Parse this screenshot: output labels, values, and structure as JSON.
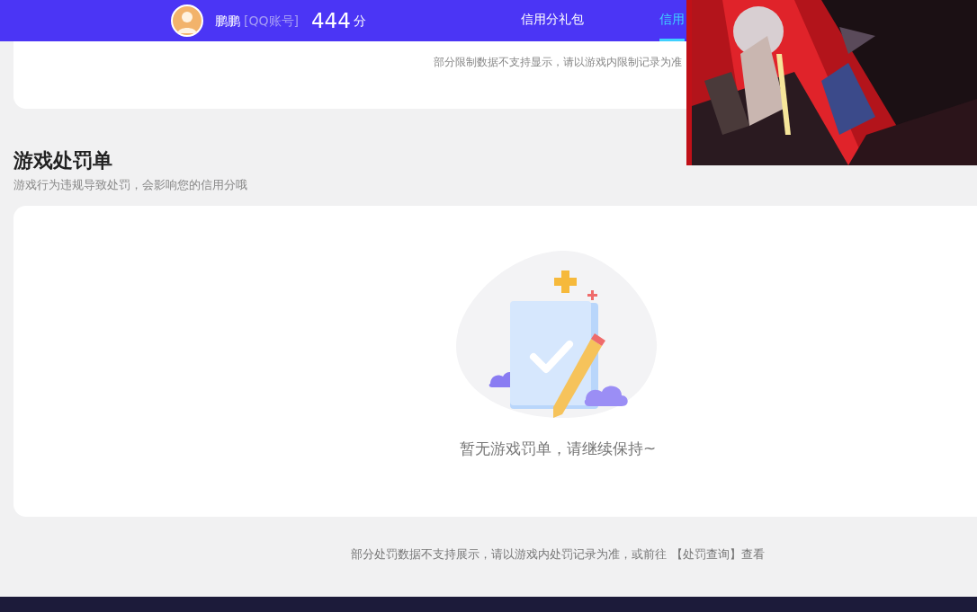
{
  "header": {
    "user_name": "鹏鹏",
    "account_type": "[QQ账号]",
    "score": "444",
    "score_unit": "分",
    "tabs": [
      {
        "label": "信用分礼包",
        "selected": false
      },
      {
        "label": "信用",
        "selected": true
      }
    ]
  },
  "restriction_card": {
    "note": "部分限制数据不支持显示，请以游戏内限制记录为准"
  },
  "penalty_section": {
    "title": "游戏处罚单",
    "subtitle": "游戏行为违规导致处罚，会影响您的信用分哦",
    "empty_text": "暂无游戏罚单，请继续保持~",
    "footer_note": "部分处罚数据不支持展示，请以游戏内处罚记录为准，或前往",
    "footer_link": "【处罚查询】",
    "footer_suffix": "查看"
  }
}
